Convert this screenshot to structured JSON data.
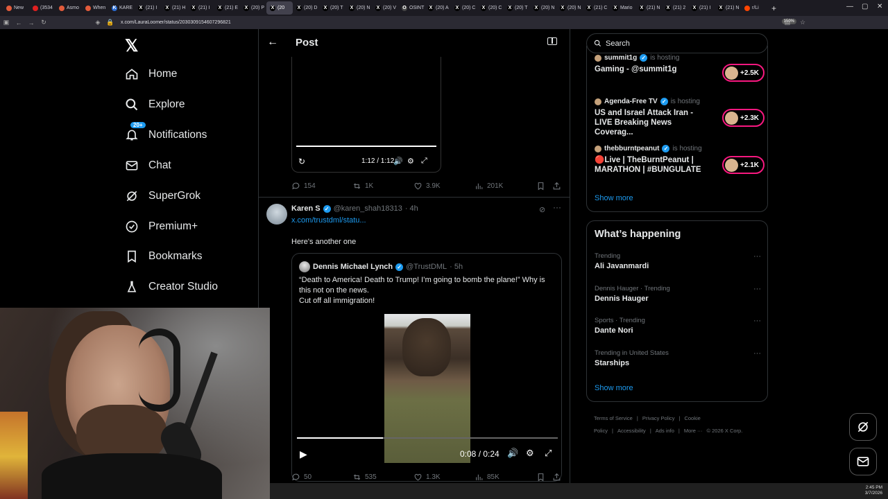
{
  "browser": {
    "tabs": [
      {
        "label": "New",
        "color": "#e25b3b",
        "glyph": ""
      },
      {
        "label": "(3534",
        "color": "#e02020",
        "glyph": ""
      },
      {
        "label": "Asmo",
        "color": "#e25b3b",
        "glyph": ""
      },
      {
        "label": "When",
        "color": "#e25b3b",
        "glyph": ""
      },
      {
        "label": "KARE",
        "color": "#2a6bd1",
        "glyph": "K"
      },
      {
        "label": "(21) I",
        "color": "#000000",
        "glyph": "X"
      },
      {
        "label": "(21) H",
        "color": "#000000",
        "glyph": "X"
      },
      {
        "label": "(21) I",
        "color": "#000000",
        "glyph": "X"
      },
      {
        "label": "(21) E",
        "color": "#000000",
        "glyph": "X"
      },
      {
        "label": "(20) P",
        "color": "#000000",
        "glyph": "X"
      },
      {
        "label": "(20",
        "color": "#000000",
        "glyph": "X",
        "active": true
      },
      {
        "label": "(20) D",
        "color": "#000000",
        "glyph": "X"
      },
      {
        "label": "(20) T",
        "color": "#000000",
        "glyph": "X"
      },
      {
        "label": "(20) N",
        "color": "#000000",
        "glyph": "X"
      },
      {
        "label": "(20) V",
        "color": "#000000",
        "glyph": "X"
      },
      {
        "label": "OSINT",
        "color": "#444444",
        "glyph": "O"
      },
      {
        "label": "(20) A",
        "color": "#000000",
        "glyph": "X"
      },
      {
        "label": "(20) C",
        "color": "#000000",
        "glyph": "X"
      },
      {
        "label": "(20) C",
        "color": "#000000",
        "glyph": "X"
      },
      {
        "label": "(20) T",
        "color": "#000000",
        "glyph": "X"
      },
      {
        "label": "(20) N",
        "color": "#000000",
        "glyph": "X"
      },
      {
        "label": "(20) N",
        "color": "#000000",
        "glyph": "X"
      },
      {
        "label": "(21) C",
        "color": "#000000",
        "glyph": "X"
      },
      {
        "label": "Mario",
        "color": "#000000",
        "glyph": "X"
      },
      {
        "label": "(21) N",
        "color": "#000000",
        "glyph": "X"
      },
      {
        "label": "(21) 2",
        "color": "#000000",
        "glyph": "X"
      },
      {
        "label": "(21) I",
        "color": "#000000",
        "glyph": "X"
      },
      {
        "label": "(21) N",
        "color": "#000000",
        "glyph": "X"
      },
      {
        "label": "r/Li",
        "color": "#ff4500",
        "glyph": ""
      }
    ],
    "url": "x.com/LauraLoomer/status/2030309154607296821",
    "zoom": "150%"
  },
  "nav": {
    "items": [
      {
        "label": "Home",
        "icon": "home-icon"
      },
      {
        "label": "Explore",
        "icon": "search-icon"
      },
      {
        "label": "Notifications",
        "icon": "bell-icon",
        "badge": "20+"
      },
      {
        "label": "Chat",
        "icon": "mail-icon"
      },
      {
        "label": "SuperGrok",
        "icon": "grok-icon"
      },
      {
        "label": "Premium+",
        "icon": "verified-icon"
      },
      {
        "label": "Bookmarks",
        "icon": "bookmark-icon"
      },
      {
        "label": "Creator Studio",
        "icon": "flask-icon"
      }
    ]
  },
  "header": {
    "title": "Post"
  },
  "video1": {
    "time": "1:12 / 1:12"
  },
  "tweet1_stats": {
    "replies": "154",
    "reposts": "1K",
    "likes": "3.9K",
    "views": "201K"
  },
  "tweet2": {
    "name": "Karen S",
    "handle": "@karen_shah18313",
    "age": "· 4h",
    "link": "x.com/trustdml/statu...",
    "text": "Here's another one",
    "stats": {
      "replies": "50",
      "reposts": "535",
      "likes": "1.3K",
      "views": "85K"
    }
  },
  "quote": {
    "name": "Dennis Michael Lynch",
    "handle": "@TrustDML",
    "age": "· 5h",
    "lines": [
      "“Death to America! Death to Trump! I’m going to bomb the plane!” Why is this not on the news.",
      "Cut off all immigration!"
    ],
    "time": "0:08 / 0:24",
    "progress": 0.33
  },
  "search": {
    "placeholder": "Search"
  },
  "spaces": [
    {
      "host": "summit1g",
      "status": "is hosting",
      "title": "Gaming - @summit1g",
      "count": "+2.5K"
    },
    {
      "host": "Agenda-Free TV",
      "status": "is hosting",
      "title": "US and Israel Attack Iran - LIVE Breaking News Coverag...",
      "count": "+2.3K"
    },
    {
      "host": "thebburntpeanut",
      "status": "is hosting",
      "title": "🔴Live | TheBurntPeanut | MARATHON | #BUNGULATE",
      "count": "+2.1K"
    }
  ],
  "spaces_showmore": "Show more",
  "happening": {
    "title": "What’s happening",
    "trends": [
      {
        "meta": "Trending",
        "name": "Ali Javanmardi"
      },
      {
        "meta": "Dennis Hauger · Trending",
        "name": "Dennis Hauger"
      },
      {
        "meta": "Sports · Trending",
        "name": "Dante Nori"
      },
      {
        "meta": "Trending in United States",
        "name": "Starships"
      }
    ],
    "showmore": "Show more"
  },
  "footer": [
    "Terms of Service",
    "|",
    "Privacy Policy",
    "|",
    "Cookie Policy",
    "|",
    "Accessibility",
    "|",
    "Ads info",
    "|",
    "More ···",
    "© 2026 X Corp."
  ],
  "system": {
    "time": "2:45 PM",
    "date": "3/7/2026"
  }
}
